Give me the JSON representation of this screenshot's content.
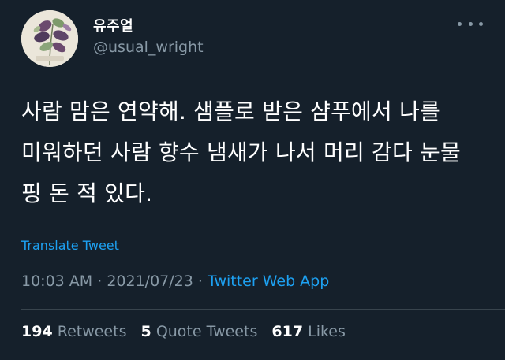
{
  "user": {
    "display_name": "유주얼",
    "handle": "@usual_wright"
  },
  "tweet": {
    "text": "사람 맘은 연약해. 샘플로 받은 샴푸에서 나를 미워하던 사람 향수 냄새가 나서 머리 감다 눈물 핑 돈 적 있다.",
    "translate_label": "Translate Tweet",
    "time": "10:03 AM",
    "separator": "·",
    "date": "2021/07/23",
    "source": "Twitter Web App"
  },
  "stats": {
    "retweets_count": "194",
    "retweets_label": "Retweets",
    "quotes_count": "5",
    "quotes_label": "Quote Tweets",
    "likes_count": "617",
    "likes_label": "Likes"
  },
  "colors": {
    "background": "#15202b",
    "secondary_text": "#8899a6",
    "link": "#1da1f2",
    "divider": "#38444d"
  },
  "icons": {
    "more": "more-horizontal-icon"
  }
}
